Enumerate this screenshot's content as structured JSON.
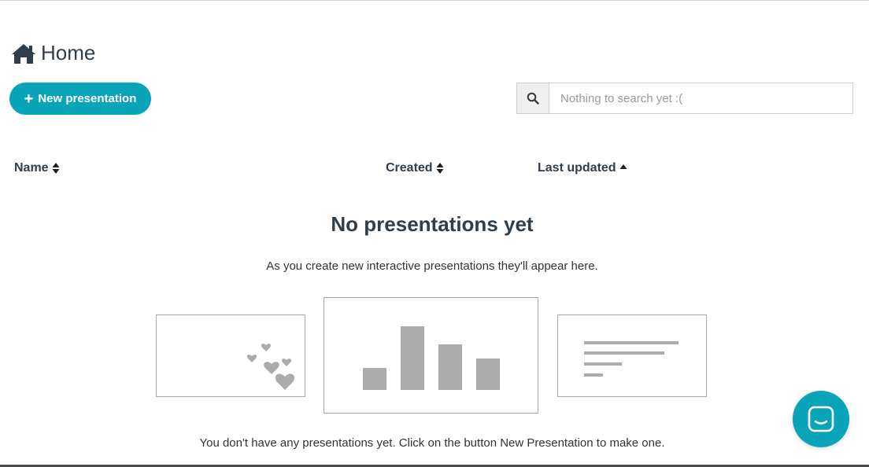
{
  "header": {
    "title": "Home"
  },
  "toolbar": {
    "new_button_label": "New presentation"
  },
  "search": {
    "placeholder": "Nothing to search yet :("
  },
  "table": {
    "columns": [
      {
        "label": "Name",
        "sort": "both"
      },
      {
        "label": "Created",
        "sort": "both"
      },
      {
        "label": "Last updated",
        "sort": "ascending"
      }
    ]
  },
  "empty_state": {
    "title": "No presentations yet",
    "subtitle": "As you create new interactive presentations they'll appear here.",
    "footer": "You don't have any presentations yet. Click on the button New Presentation to make one."
  },
  "icons": {
    "home": "home-icon",
    "plus": "plus-icon",
    "search": "search-icon",
    "sort": "sort-icon",
    "chat": "chat-icon"
  },
  "colors": {
    "accent": "#0aa4b8",
    "text": "#2f3e4a",
    "placeholder_gray": "#a8a8a8"
  }
}
